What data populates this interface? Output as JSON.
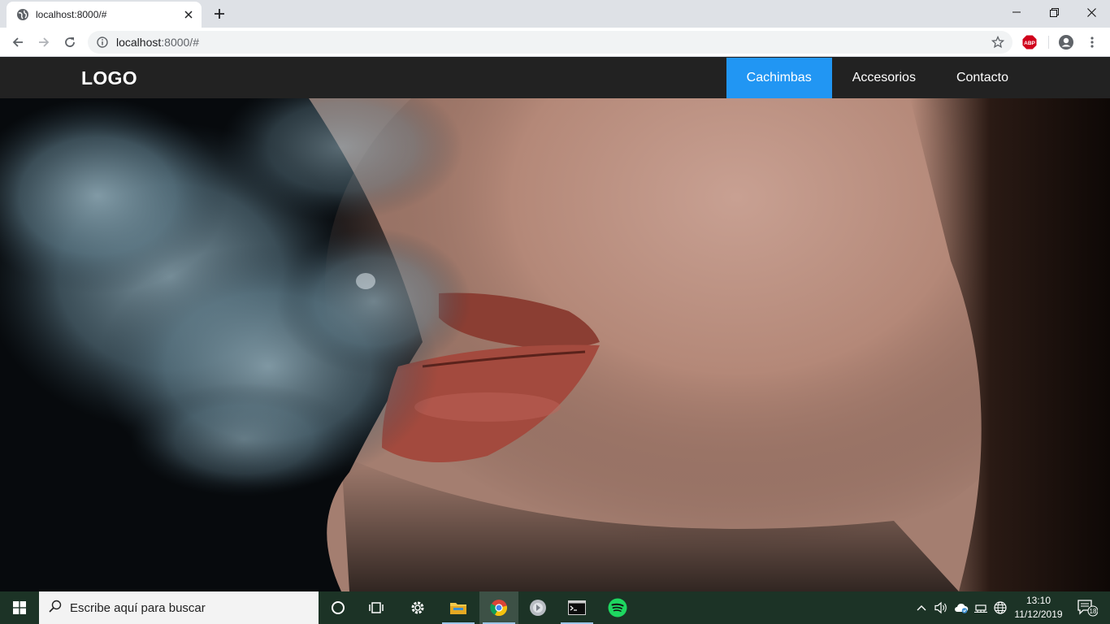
{
  "browser": {
    "tab": {
      "title": "localhost:8000/#"
    },
    "address": {
      "host": "localhost",
      "rest": ":8000/#"
    },
    "extension_badge": "ABP"
  },
  "site": {
    "logo": "LOGO",
    "nav": [
      {
        "label": "Cachimbas",
        "active": true
      },
      {
        "label": "Accesorios",
        "active": false
      },
      {
        "label": "Contacto",
        "active": false
      }
    ],
    "accent_color": "#2196f3",
    "navbar_color": "#222222"
  },
  "taskbar": {
    "search_placeholder": "Escribe aquí para buscar",
    "time": "13:10",
    "date": "11/12/2019",
    "notifications": "18",
    "apps": [
      "cortana-icon",
      "task-view-icon",
      "settings-icon",
      "file-explorer-icon",
      "chrome-icon",
      "audio-app-icon",
      "terminal-icon",
      "spotify-icon"
    ]
  }
}
